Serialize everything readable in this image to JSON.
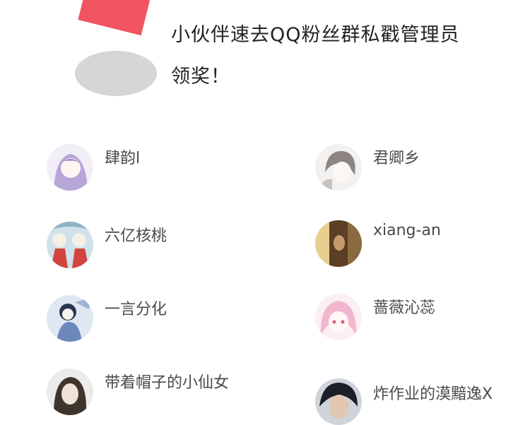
{
  "announcement": {
    "cut_line": "",
    "line1": "小伙伴速去QQ粉丝群私戳管理员",
    "line2": "领奖！"
  },
  "winners": [
    {
      "name": "肆韵l",
      "avatar_icon": "anime-girl-purple-icon",
      "color": "#b7a6d8"
    },
    {
      "name": "君卿乡",
      "avatar_icon": "anime-boy-gray-icon",
      "color": "#b3aba8"
    },
    {
      "name": "六亿核桃",
      "avatar_icon": "anime-duo-red-icon",
      "color": "#d2453e"
    },
    {
      "name": "xiang-an",
      "avatar_icon": "photo-doorway-icon",
      "color": "#8b6a3f"
    },
    {
      "name": "一言分化",
      "avatar_icon": "anime-sketch-blue-icon",
      "color": "#6c88bb"
    },
    {
      "name": "蔷薇沁蕊",
      "avatar_icon": "anime-pink-hair-icon",
      "color": "#f2b7cf"
    },
    {
      "name": "带着帽子的小仙女",
      "avatar_icon": "photo-girl-icon",
      "color": "#6e5a4c"
    },
    {
      "name": "炸作业的漠黯逸X",
      "avatar_icon": "photo-boy-dark-icon",
      "color": "#2b3140"
    }
  ]
}
